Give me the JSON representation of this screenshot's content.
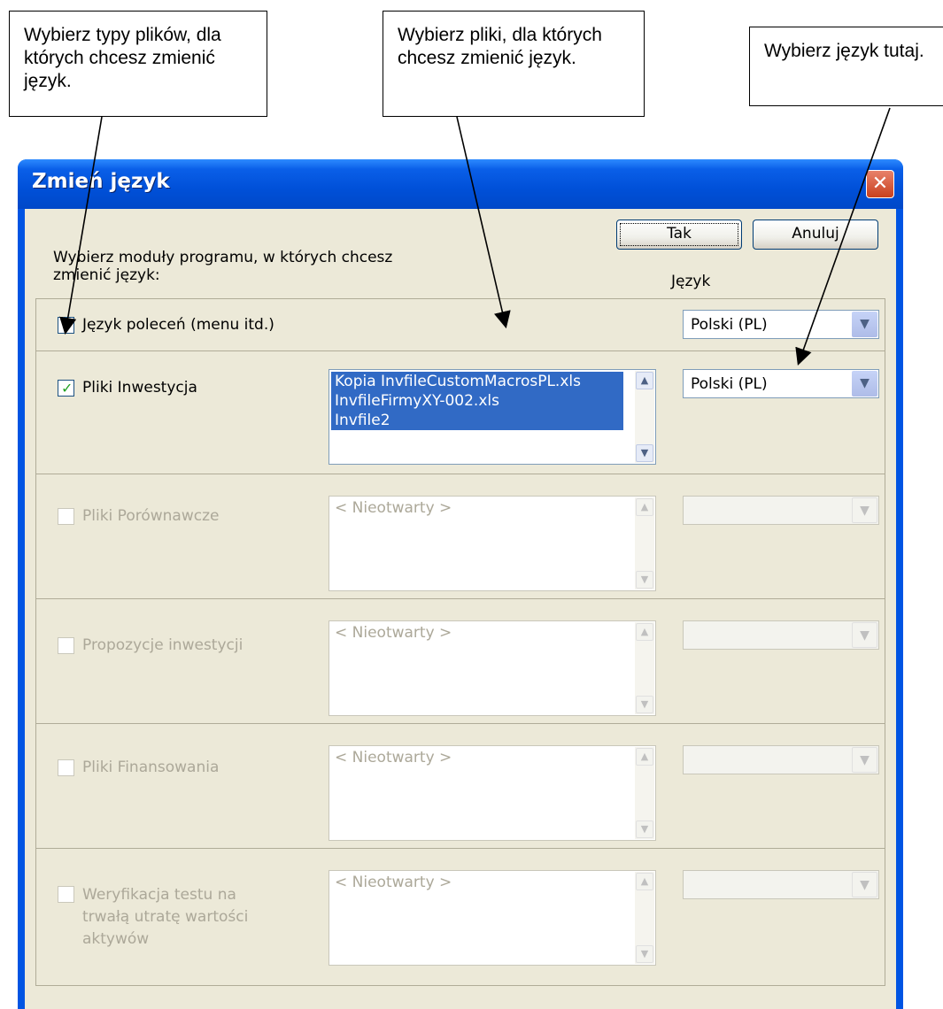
{
  "callouts": [
    {
      "text": "Wybierz typy plików, dla których chcesz zmienić język."
    },
    {
      "text": "Wybierz pliki, dla których chcesz zmienić język."
    },
    {
      "text": "Wybierz język tutaj."
    }
  ],
  "dialog": {
    "title": "Zmień język",
    "close_label": "✕",
    "ok_label": "Tak",
    "cancel_label": "Anuluj",
    "instruction_line1": "Wybierz moduły programu, w których chcesz",
    "instruction_line2": "zmienić język:",
    "language_header": "Język"
  },
  "rows": [
    {
      "label": "Język poleceń (menu itd.)",
      "checked": true,
      "enabled": true,
      "language": "Polski (PL)"
    },
    {
      "label": "Pliki Inwestycja",
      "checked": true,
      "enabled": true,
      "language": "Polski (PL)",
      "files": [
        "Kopia InvfileCustomMacrosPL.xls",
        "InvfileFirmyXY-002.xls",
        "Invfile2"
      ]
    },
    {
      "label": "Pliki Porównawcze",
      "checked": false,
      "enabled": false,
      "files": [
        "< Nieotwarty >"
      ]
    },
    {
      "label": "Propozycje inwestycji",
      "checked": false,
      "enabled": false,
      "files": [
        "< Nieotwarty >"
      ]
    },
    {
      "label": "Pliki Finansowania",
      "checked": false,
      "enabled": false,
      "files": [
        "< Nieotwarty >"
      ]
    },
    {
      "label_lines": [
        "Weryfikacja testu na",
        "trwałą utratę wartości",
        "aktywów"
      ],
      "checked": false,
      "enabled": false,
      "files": [
        "< Nieotwarty >"
      ]
    }
  ],
  "icons": {
    "check": "✓",
    "scroll_up": "▲",
    "scroll_down": "▼",
    "dropdown": "▼"
  },
  "colors": {
    "titlebar": "#0054e3",
    "dialog_bg": "#ece9d8",
    "selection": "#316ac5",
    "check": "#21a121"
  }
}
